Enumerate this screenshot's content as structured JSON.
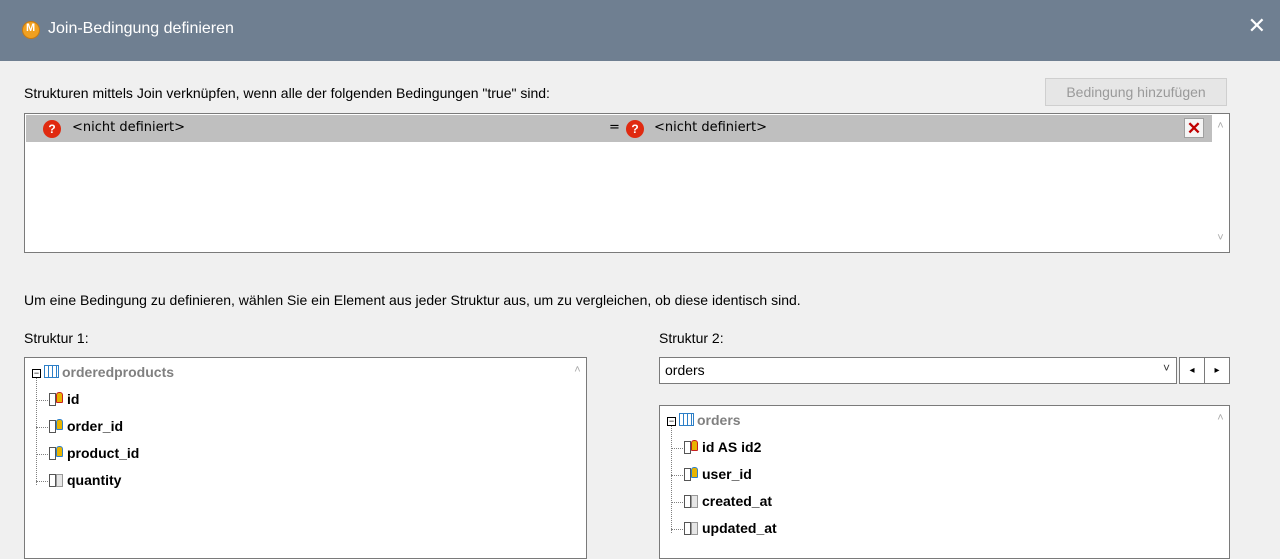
{
  "window": {
    "title": "Join-Bedingung definieren",
    "close_glyph": "✕",
    "icon": "app-logo-icon"
  },
  "conditions": {
    "instruction": "Strukturen mittels Join verknüpfen, wenn alle der folgenden Bedingungen \"true\" sind:",
    "add_button": "Bedingung hinzufügen",
    "rows": [
      {
        "left": "<nicht definiert>",
        "operator": "=",
        "right": "<nicht definiert>",
        "delete_glyph": "✕"
      }
    ]
  },
  "hint": "Um eine Bedingung zu definieren, wählen Sie ein Element aus jeder Struktur aus, um zu vergleichen, ob diese identisch sind.",
  "structure1": {
    "label": "Struktur 1:",
    "root": "orderedproducts",
    "children": [
      "id",
      "order_id",
      "product_id",
      "quantity"
    ]
  },
  "structure2": {
    "label": "Struktur 2:",
    "selected": "orders",
    "root": "orders",
    "children": [
      "id AS id2",
      "user_id",
      "created_at",
      "updated_at"
    ]
  }
}
